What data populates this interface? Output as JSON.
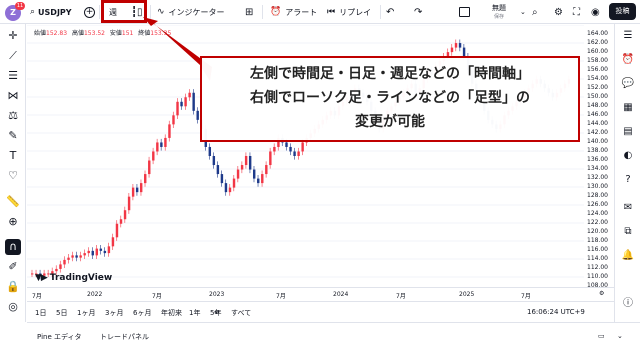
{
  "topbar": {
    "avatar_letter": "Z",
    "avatar_badge": "11",
    "symbol": "USDJPY",
    "add_symbol": "+",
    "interval": "週",
    "indicators_label": "インジケーター",
    "alert_label": "アラート",
    "replay_label": "リプレイ",
    "save_label": "無題",
    "save_sub": "保存",
    "publish_label": "投稿"
  },
  "ohlc": {
    "open_label": "始値",
    "open": "152.83",
    "high_label": "高値",
    "high": "153.52",
    "low_label": "安値",
    "low": "151",
    "close_label": "終値",
    "close": "153.35"
  },
  "price_axis": [
    "164.00",
    "162.00",
    "160.00",
    "158.00",
    "156.00",
    "154.00",
    "152.00",
    "150.00",
    "148.00",
    "146.00",
    "144.00",
    "142.00",
    "140.00",
    "138.00",
    "136.00",
    "134.00",
    "132.00",
    "130.00",
    "128.00",
    "126.00",
    "124.00",
    "122.00",
    "120.00",
    "118.00",
    "116.00",
    "114.00",
    "112.00",
    "110.00",
    "108.00"
  ],
  "time_axis": [
    "7月",
    "2022",
    "7月",
    "2023",
    "7月",
    "2024",
    "7月",
    "2025",
    "7月"
  ],
  "logo_text": "TradingView",
  "range_bar": {
    "ranges": [
      "1日",
      "5日",
      "1ヶ月",
      "3ヶ月",
      "6ヶ月",
      "年初来",
      "1年",
      "5年",
      "すべて"
    ],
    "clock": "16:06:24 UTC+9"
  },
  "panel_bar": {
    "pine_editor": "Pine エディタ",
    "trade_panel": "トレードパネル"
  },
  "callout": {
    "line1": "左側で時間足・日足・週足などの「時間軸」",
    "line2": "右側でローソク足・ラインなどの「足型」の",
    "line3": "変更が可能"
  },
  "colors": {
    "up": "#f23645",
    "down": "#1e3a8a",
    "annotation": "#c00000",
    "accent": "#2962ff"
  },
  "chart_data": {
    "type": "candlestick",
    "y_axis_range": [
      107,
      165
    ],
    "note_values": "approximate weekly closes read from chart",
    "closes": [
      110,
      110,
      109.5,
      110,
      110,
      110.5,
      111,
      112,
      113,
      113.5,
      114,
      113.5,
      114,
      114.5,
      115,
      114,
      115.5,
      115,
      114.5,
      116,
      118,
      121,
      122,
      124,
      127,
      129,
      128,
      130,
      132,
      135,
      137,
      139,
      138,
      140,
      143,
      145,
      148,
      147,
      149,
      150,
      146,
      144,
      142,
      138,
      136,
      134,
      132,
      130,
      128,
      129,
      131,
      133,
      134,
      136,
      133,
      131,
      130,
      132,
      134,
      137,
      138,
      140,
      139,
      138,
      137,
      136,
      137,
      139,
      140,
      141,
      142,
      143,
      144,
      145,
      146,
      145,
      147,
      148,
      149,
      150,
      151,
      150,
      149,
      148,
      146,
      144,
      142,
      144,
      146,
      147,
      148,
      149,
      150,
      151,
      152,
      150,
      151,
      153,
      155,
      154,
      156,
      157,
      158,
      159,
      160,
      161,
      160,
      158,
      155,
      152,
      150,
      148,
      146,
      144,
      143,
      142,
      143,
      145,
      146,
      147,
      148,
      149,
      150,
      151,
      152,
      153,
      152,
      151,
      150,
      149,
      150,
      151,
      152,
      153
    ]
  }
}
